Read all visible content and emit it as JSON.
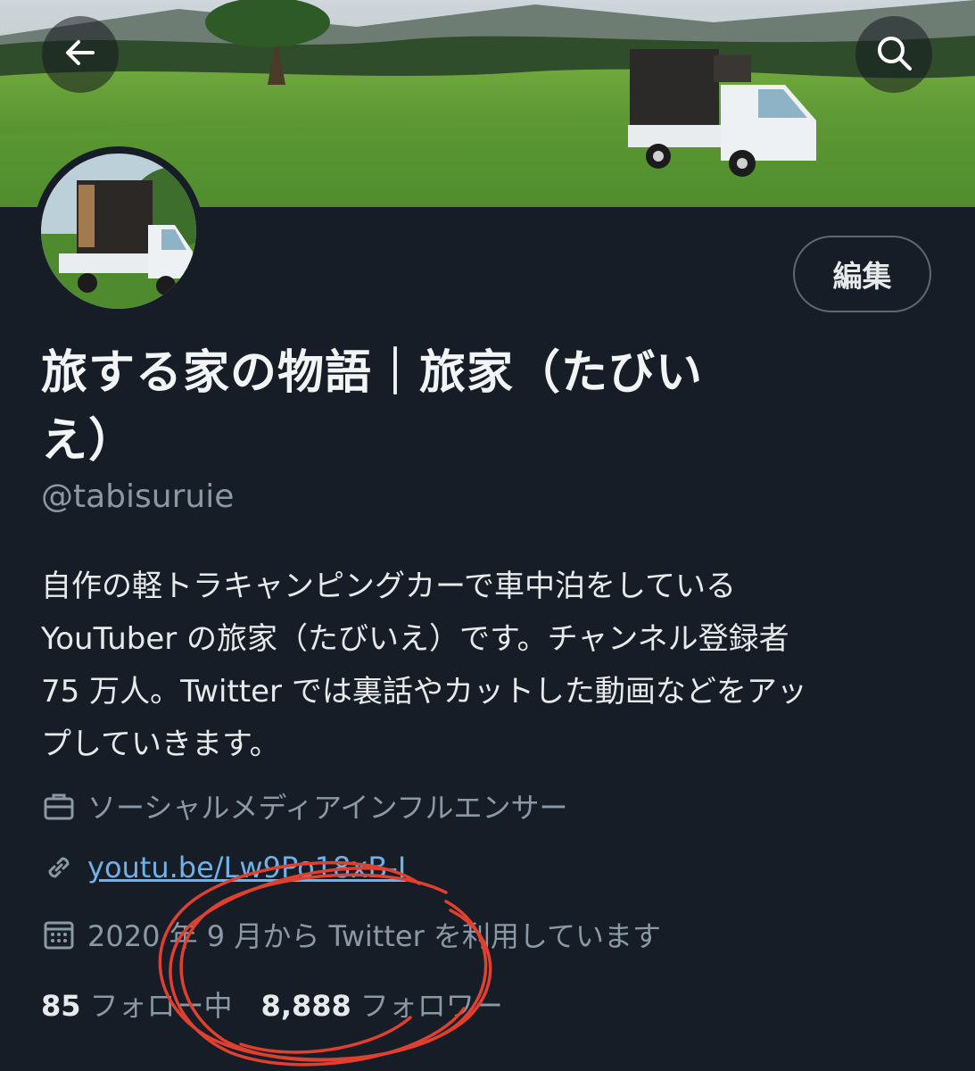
{
  "header": {
    "back_icon": "arrow-left-icon",
    "search_icon": "search-icon"
  },
  "profile": {
    "edit_label": "編集",
    "name_line1": "旅する家の物語｜旅家（たびい",
    "name_line2": "え）",
    "handle": "@tabisuruie",
    "bio_lines": [
      "自作の軽トラキャンピングカーで車中泊をしている",
      "YouTuber の旅家（たびいえ）です。チャンネル登録者",
      "75 万人。Twitter では裏話やカットした動画などをアッ",
      "プしていきます。"
    ],
    "category": "ソーシャルメディアインフルエンサー",
    "link": "youtu.be/Lw9Po18xB-I",
    "joined": "2020 年 9 月から Twitter を利用しています",
    "following_count": "85",
    "following_label": "フォロー中",
    "followers_count": "8,888",
    "followers_label": "フォロワー"
  },
  "colors": {
    "background": "#161d27",
    "text": "#e7e9ea",
    "secondary": "#8b98a5",
    "link": "#6fb2e8",
    "annotation": "#e0402f"
  }
}
